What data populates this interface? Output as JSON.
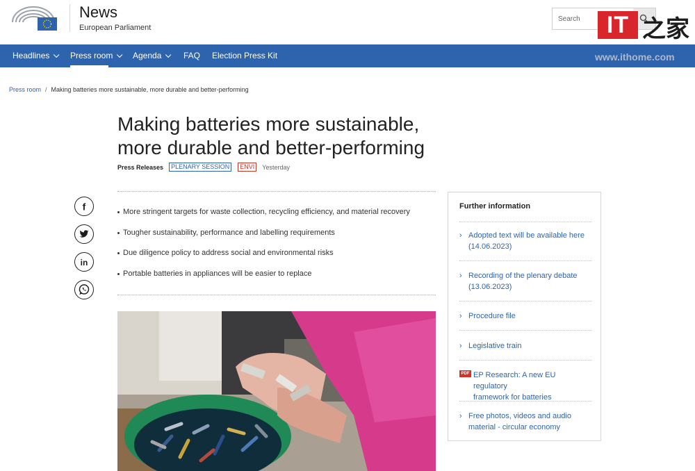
{
  "header": {
    "site_title": "News",
    "site_subtitle": "European Parliament",
    "search_placeholder": "Search"
  },
  "watermark": {
    "logo_text": "IT",
    "cn_text": "之家",
    "url": "www.ithome.com"
  },
  "nav": {
    "items": [
      {
        "label": "Headlines",
        "dropdown": true
      },
      {
        "label": "Press room",
        "dropdown": true,
        "active": true
      },
      {
        "label": "Agenda",
        "dropdown": true
      },
      {
        "label": "FAQ",
        "dropdown": false
      },
      {
        "label": "Election Press Kit",
        "dropdown": false
      }
    ]
  },
  "breadcrumb": {
    "root": "Press room",
    "separator": "/",
    "current": "Making batteries more sustainable, more durable and better-performing"
  },
  "article": {
    "title_line1": "Making batteries more sustainable,",
    "title_line2": "more durable and better-performing",
    "type": "Press Releases",
    "tag1": "PLENARY SESSION",
    "tag2": "ENVI",
    "date": "Yesterday",
    "bullets": [
      "More stringent targets for waste collection, recycling efficiency, and material recovery",
      "Tougher sustainability, performance and labelling requirements",
      "Due diligence policy to address social and environmental risks",
      "Portable batteries in appliances will be easier to replace"
    ]
  },
  "share": {
    "icons": [
      "facebook-icon",
      "twitter-icon",
      "linkedin-icon",
      "whatsapp-icon"
    ]
  },
  "further": {
    "heading": "Further information",
    "items": [
      {
        "line1": "Adopted text will be available here",
        "line2": "(14.06.2023)"
      },
      {
        "line1": "Recording of the plenary debate",
        "line2": "(13.06.2023)"
      },
      {
        "line1": "Procedure file",
        "line2": ""
      },
      {
        "line1": "Legislative train",
        "line2": ""
      },
      {
        "line1": "EP Research: A new EU regulatory",
        "line2": "framework for batteries",
        "pdf": true
      },
      {
        "line1": "Free photos, videos and audio",
        "line2": "material - circular economy"
      }
    ],
    "pdf_label": "PDF"
  },
  "colors": {
    "nav_bg": "#2e64ad",
    "link": "#2e64ad",
    "tag_red": "#c0392b"
  }
}
